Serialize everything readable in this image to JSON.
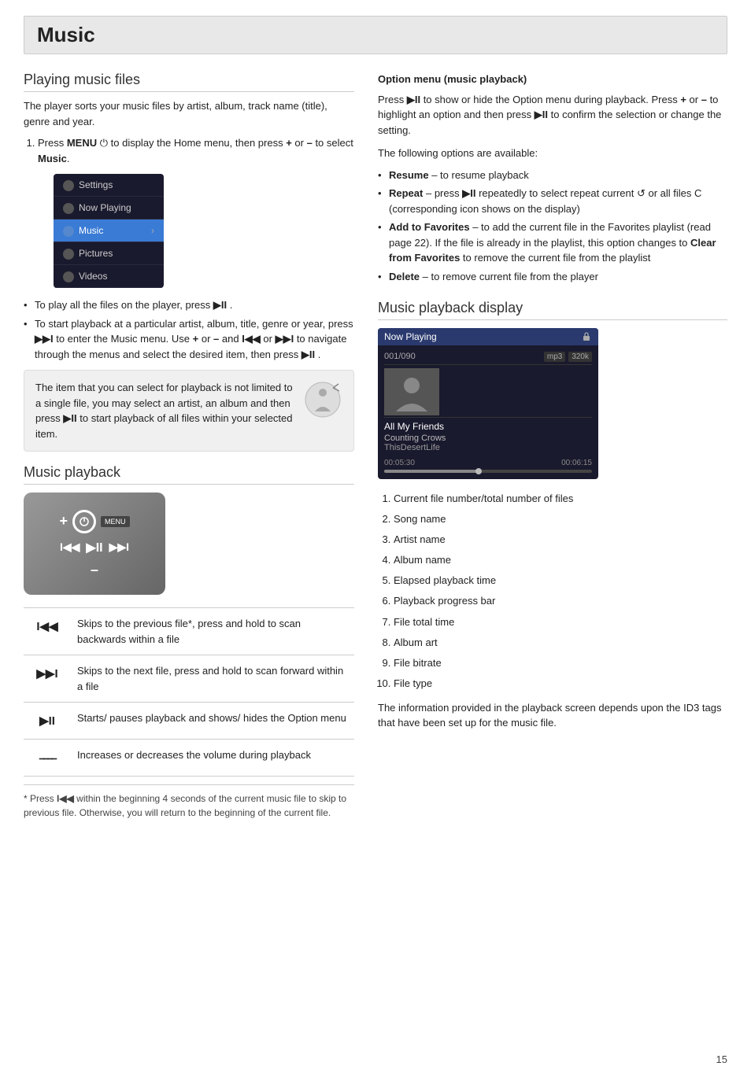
{
  "page": {
    "title": "Music",
    "page_number": "15"
  },
  "playing_music_files": {
    "heading": "Playing music files",
    "intro": "The player sorts your music files by artist, album, track name (title), genre and year.",
    "step1_text": "Press ",
    "step1_menu": "MENU",
    "step1_cont": " to display the Home menu, then press + or – to select ",
    "step1_music": "Music",
    "step1_end": ".",
    "menu_items": [
      {
        "label": "Settings",
        "active": false
      },
      {
        "label": "Now Playing",
        "active": false
      },
      {
        "label": "Music",
        "active": true,
        "arrow": true
      },
      {
        "label": "Pictures",
        "active": false
      },
      {
        "label": "Videos",
        "active": false
      }
    ],
    "bullet1": "To play all the files on the player, press ▶II .",
    "bullet2": "To start playback at a particular artist, album, title, genre or year, press ▶▶I to enter the Music menu. Use + or – and I◀◀ or ▶▶I to navigate through the menus and select the desired item, then press ▶II .",
    "info_box": "The item that you can select for playback is not limited to a single file, you may select an artist, an album and then press ▶II to start playback of all files within your selected item."
  },
  "music_playback": {
    "heading": "Music playback",
    "device_labels": {
      "plus": "+",
      "minus": "–",
      "menu": "MENU",
      "prev": "I◀◀",
      "playpause": "▶II",
      "next": "▶▶I"
    }
  },
  "controls_table": {
    "rows": [
      {
        "symbol": "I◀◀",
        "description": "Skips to the previous file*, press and hold to scan backwards within a file"
      },
      {
        "symbol": "▶▶I",
        "description": "Skips to the next file, press and hold to scan forward within a file"
      },
      {
        "symbol": "▶II",
        "description": "Starts/ pauses playback and shows/ hides the Option menu"
      },
      {
        "symbol": "~////",
        "description": "Increases or decreases the volume during playback"
      }
    ]
  },
  "footer_note": "* Press I◀◀ within the beginning 4 seconds of the current music file to skip to previous file. Otherwise, you will return to the beginning of the current file.",
  "option_menu": {
    "heading": "Option menu (music playback)",
    "intro": "Press ▶II to show or hide the Option menu during playback. Press + or – to highlight an option and then press ▶II to confirm the selection or change the setting.",
    "available_label": "The following options are available:",
    "options": [
      {
        "label": "Resume",
        "bold": true,
        "text": " – to resume playback"
      },
      {
        "label": "Repeat",
        "bold": true,
        "text": " – press ▶II repeatedly to select repeat current 🔁 or all files C (corresponding icon shows on the display)"
      },
      {
        "label": "Add to Favorites",
        "bold": true,
        "text": " – to add the current file in the Favorites playlist (read page 22). If the file is already in the playlist, this option changes to ",
        "bold2": "Clear from Favorites",
        "text2": " to remove the current file from the playlist"
      },
      {
        "label": "Delete",
        "bold": true,
        "text": " – to remove current file from the player"
      }
    ]
  },
  "music_playback_display": {
    "heading": "Music playback display",
    "now_playing_label": "Now Playing",
    "counter": "001/090",
    "format": "mp3",
    "bitrate": "320k",
    "song": "All My Friends",
    "artist": "Counting Crows",
    "album": "ThisDesertLife",
    "elapsed": "00:05:30",
    "total": "00:06:15",
    "progress_pct": 46,
    "numbered_items": [
      "Current file number/total number of files",
      "Song name",
      "Artist name",
      "Album name",
      "Elapsed playback time",
      "Playback progress bar",
      "File total time",
      "Album art",
      "File bitrate",
      "File type"
    ],
    "info_text": "The information provided in the playback screen depends upon the ID3 tags that have been set up for the music file."
  }
}
